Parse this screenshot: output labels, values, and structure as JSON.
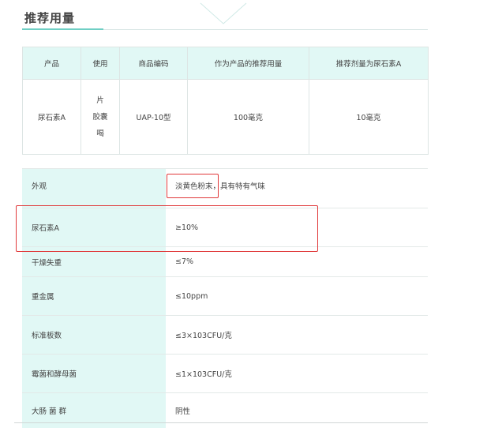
{
  "section": {
    "title": "推荐用量"
  },
  "dose_table": {
    "headers": [
      "产品",
      "使用",
      "商品编码",
      "作为产品的推荐用量",
      "推荐剂量为尿石素A"
    ],
    "row": {
      "product": "尿石素A",
      "usage": [
        "片",
        "胶囊",
        "喝"
      ],
      "code": "UAP-10型",
      "recommended": "100毫克",
      "urolithin_dose": "10毫克"
    }
  },
  "spec_table": {
    "rows": [
      {
        "label": "外观",
        "value_highlight": "淡黄色粉末，",
        "value_rest": "具有特有气味"
      },
      {
        "label": "尿石素A",
        "value": "≥10%"
      },
      {
        "label": "干燥失重",
        "value": "≤7%"
      },
      {
        "label": "重金属",
        "value": "≤10ppm"
      },
      {
        "label": "标准板数",
        "value": "≤3×103CFU/克"
      },
      {
        "label": "霉菌和酵母菌",
        "value": "≤1×103CFU/克"
      },
      {
        "label": "大肠 菌 群",
        "value": "阴性"
      }
    ]
  },
  "colors": {
    "accent": "#6fcfc4",
    "header_bg": "#e1f8f5",
    "highlight": "#e0393a"
  }
}
